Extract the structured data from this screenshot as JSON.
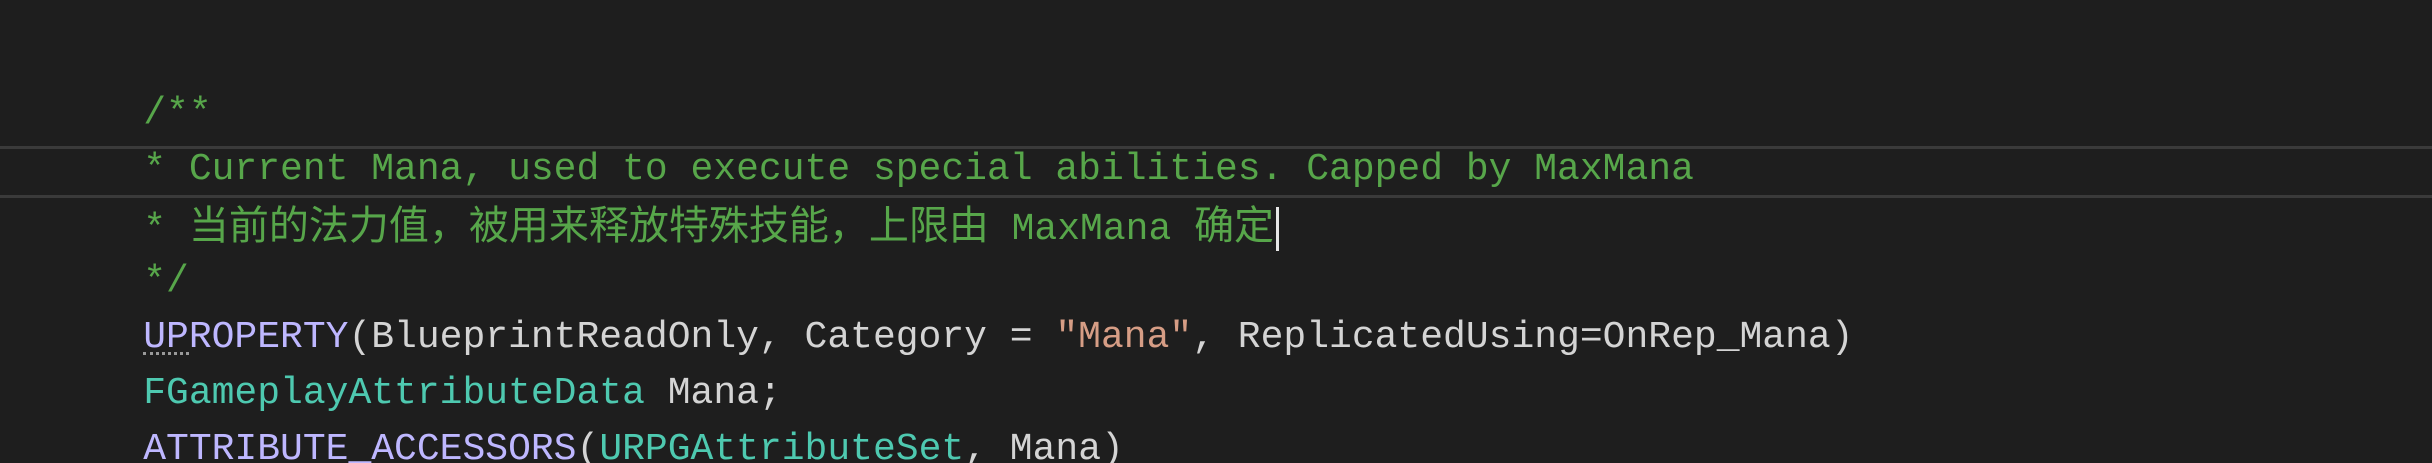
{
  "editor": {
    "lines": [
      {
        "comment": "/**"
      },
      {
        "comment": "* Current Mana, used to execute special abilities. Capped by MaxMana"
      },
      {
        "prefix": "* ",
        "cjk_a": "当前的法力值，被用来释放特殊技能，上限由",
        "mid": " MaxMana ",
        "cjk_b": "确定"
      },
      {
        "comment": "*/"
      },
      {
        "macro": "UPROPERTY",
        "p1": "(BlueprintReadOnly, Category = ",
        "str": "\"Mana\"",
        "p2": ", ReplicatedUsing=OnRep_Mana)"
      },
      {
        "type": "FGameplayAttributeData",
        "rest": " Mana;"
      },
      {
        "macro": "ATTRIBUTE_ACCESSORS",
        "open": "(",
        "type": "URPGAttributeSet",
        "rest": ", Mana)"
      }
    ]
  },
  "colors": {
    "background": "#1e1e1e",
    "comment": "#57a64a",
    "macro": "#beb7ff",
    "type": "#4ec9b0",
    "string": "#d69d85",
    "text": "#d4d4d4"
  }
}
